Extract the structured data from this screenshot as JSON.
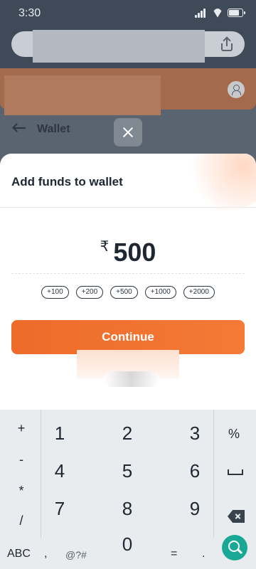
{
  "status_bar": {
    "time": "3:30"
  },
  "header": {
    "back_title": "Wallet"
  },
  "sheet": {
    "title": "Add funds to wallet",
    "currency_symbol": "₹",
    "amount": "500",
    "quick_add": [
      "+100",
      "+200",
      "+500",
      "+1000",
      "+2000"
    ],
    "continue_label": "Continue"
  },
  "keyboard": {
    "left_column": [
      "+",
      "-",
      "*",
      "/"
    ],
    "digits": [
      "1",
      "2",
      "3",
      "4",
      "5",
      "6",
      "7",
      "8",
      "9",
      "0"
    ],
    "right_column_top": "%",
    "bottom_row": {
      "abc": "ABC",
      "comma": ",",
      "symbols": "@?#",
      "equals": "=",
      "period": "."
    }
  }
}
